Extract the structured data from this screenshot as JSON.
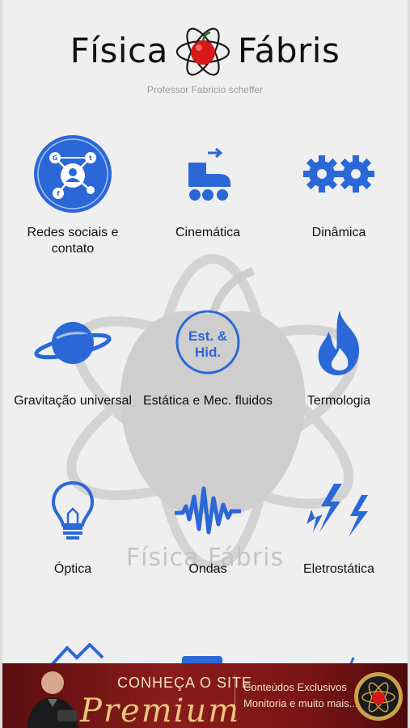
{
  "header": {
    "title_left": "Física",
    "title_right": "Fábris",
    "subtitle": "Professor Fabricio scheffer"
  },
  "watermark": {
    "text": "Física Fábris"
  },
  "colors": {
    "accent": "#2a68d8",
    "banner": "#7a1515",
    "gold": "#e8c77a"
  },
  "menu": [
    {
      "label": "Redes sociais e contato",
      "icon": "social-network-icon"
    },
    {
      "label": "Cinemática",
      "icon": "roller-skate-icon"
    },
    {
      "label": "Dinâmica",
      "icon": "gears-icon"
    },
    {
      "label": "Gravitação universal",
      "icon": "planet-icon"
    },
    {
      "label": "Estática e Mec. fluidos",
      "icon": "est-hid-icon",
      "icon_text_1": "Est. &",
      "icon_text_2": "Hid."
    },
    {
      "label": "Termologia",
      "icon": "flame-icon"
    },
    {
      "label": "Óptica",
      "icon": "light-bulb-icon"
    },
    {
      "label": "Ondas",
      "icon": "wave-icon"
    },
    {
      "label": "Eletrostática",
      "icon": "lightning-icon"
    }
  ],
  "banner": {
    "cta_line": "CONHEÇA O SITE",
    "premium": "Premium",
    "info_1": "Conteúdos Exclusivos",
    "info_2": "Monitoria e muito mais..."
  }
}
